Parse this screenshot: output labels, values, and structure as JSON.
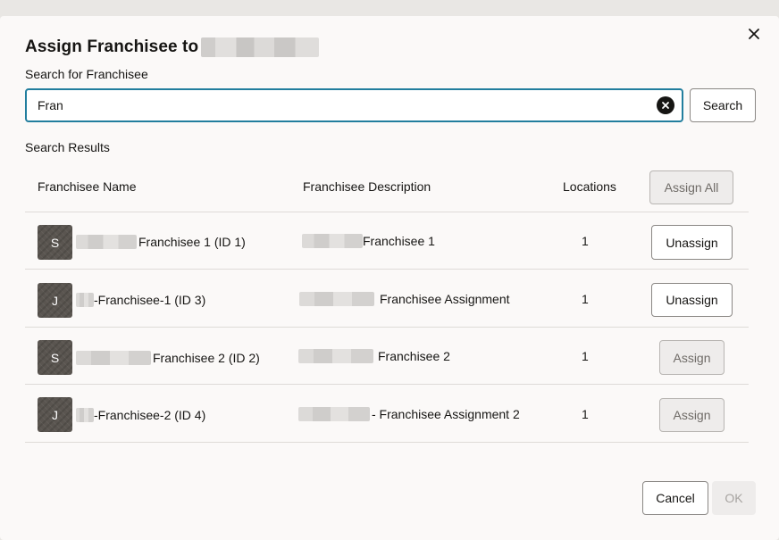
{
  "dialog": {
    "title": "Assign Franchisee to",
    "search_label": "Search for Franchisee",
    "search_value": "Fran",
    "search_button": "Search",
    "results_label": "Search Results",
    "columns": {
      "name": "Franchisee Name",
      "description": "Franchisee Description",
      "locations": "Locations",
      "assign_all": "Assign All"
    },
    "rows": [
      {
        "avatar": "S",
        "name": "Franchisee 1 (ID 1)",
        "description": "Franchisee 1",
        "locations": "1",
        "action": "Unassign"
      },
      {
        "avatar": "J",
        "name": "-Franchisee-1 (ID 3)",
        "description": "Franchisee Assignment",
        "locations": "1",
        "action": "Unassign"
      },
      {
        "avatar": "S",
        "name": "Franchisee 2 (ID 2)",
        "description": "Franchisee 2",
        "locations": "1",
        "action": "Assign"
      },
      {
        "avatar": "J",
        "name": "-Franchisee-2 (ID 4)",
        "description": "- Franchisee Assignment 2",
        "locations": "1",
        "action": "Assign"
      }
    ],
    "cancel_button": "Cancel",
    "ok_button": "OK"
  },
  "colors": {
    "focus_border": "#227e9e",
    "avatar_bg": "#5a5550",
    "dialog_bg": "#fbf9f8"
  }
}
